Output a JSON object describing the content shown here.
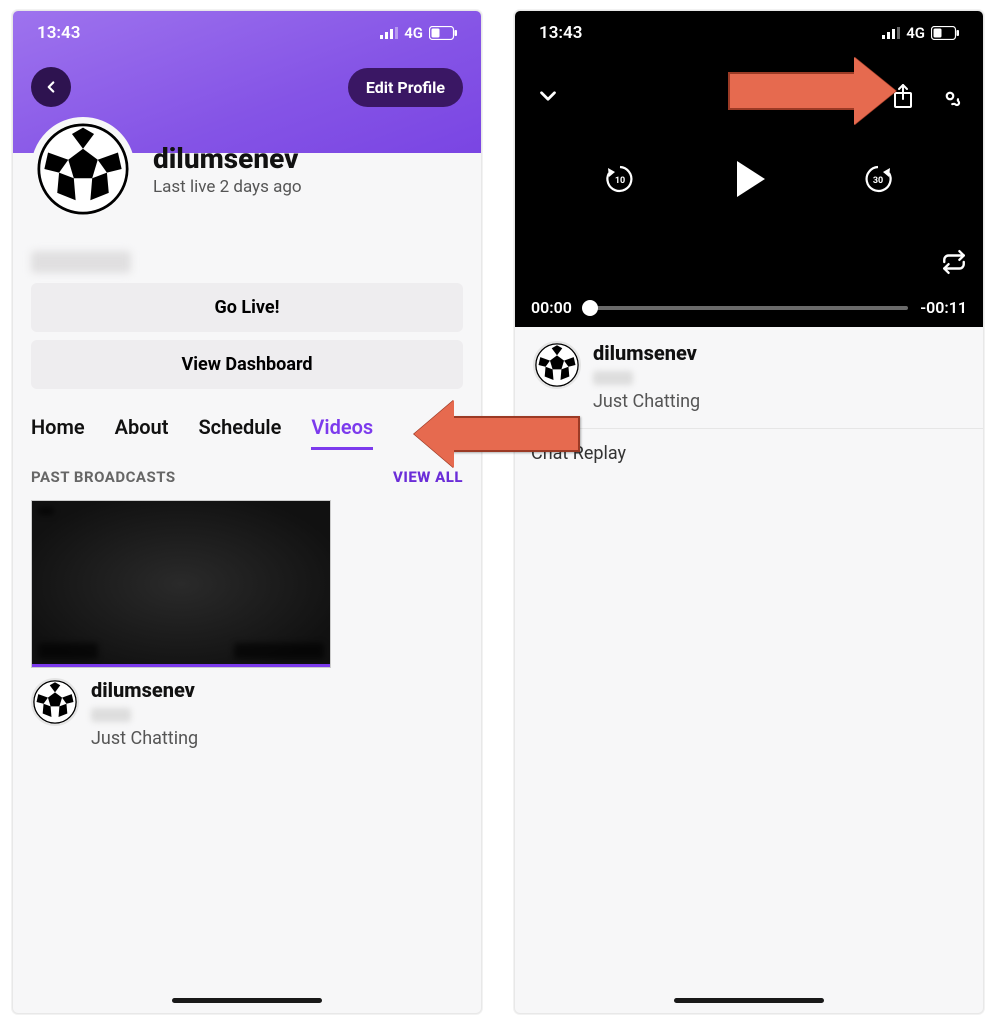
{
  "status": {
    "time": "13:43",
    "network": "4G"
  },
  "left": {
    "edit_profile": "Edit Profile",
    "username": "dilumsenev",
    "last_live": "Last live 2 days ago",
    "go_live": "Go Live!",
    "view_dashboard": "View Dashboard",
    "tabs": {
      "home": "Home",
      "about": "About",
      "schedule": "Schedule",
      "videos": "Videos"
    },
    "section_label": "PAST BROADCASTS",
    "view_all": "VIEW ALL",
    "video": {
      "title": "dilumsenev",
      "category": "Just Chatting"
    }
  },
  "right": {
    "video": {
      "title": "dilumsenev",
      "category": "Just Chatting"
    },
    "time_current": "00:00",
    "time_remaining": "-00:11",
    "chat_replay": "Chat Replay"
  },
  "colors": {
    "accent": "#7c3aed",
    "arrow": "#e66a4f"
  }
}
